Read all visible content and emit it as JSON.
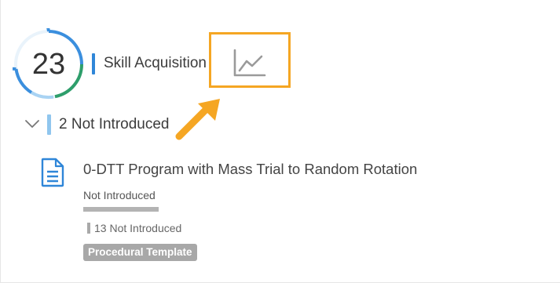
{
  "summary": {
    "count": "23",
    "section_title": "Skill Acquisition"
  },
  "toolbar": {
    "chart_icon": "line-chart-icon"
  },
  "group": {
    "title": "2 Not Introduced",
    "expanded": true
  },
  "item": {
    "title": "0-DTT Program with Mass Trial to Random Rotation",
    "status": "Not Introduced",
    "status_count": "13 Not Introduced",
    "badge": "Procedural Template",
    "progress": 1.0
  },
  "colors": {
    "accent_blue": "#2f86d8",
    "light_blue": "#90c6ee",
    "ring_green": "#2e9e6b",
    "highlight": "#f5a623",
    "badge_gray": "#a8a8a8"
  }
}
